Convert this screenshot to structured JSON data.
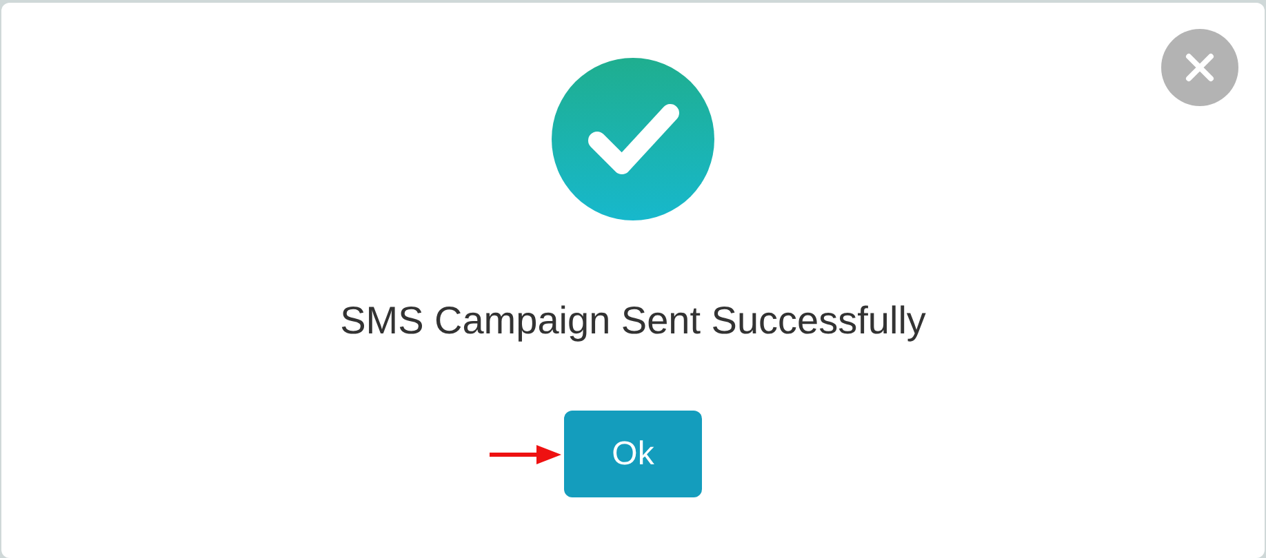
{
  "dialog": {
    "message": "SMS Campaign Sent Successfully",
    "button": "Ok"
  }
}
